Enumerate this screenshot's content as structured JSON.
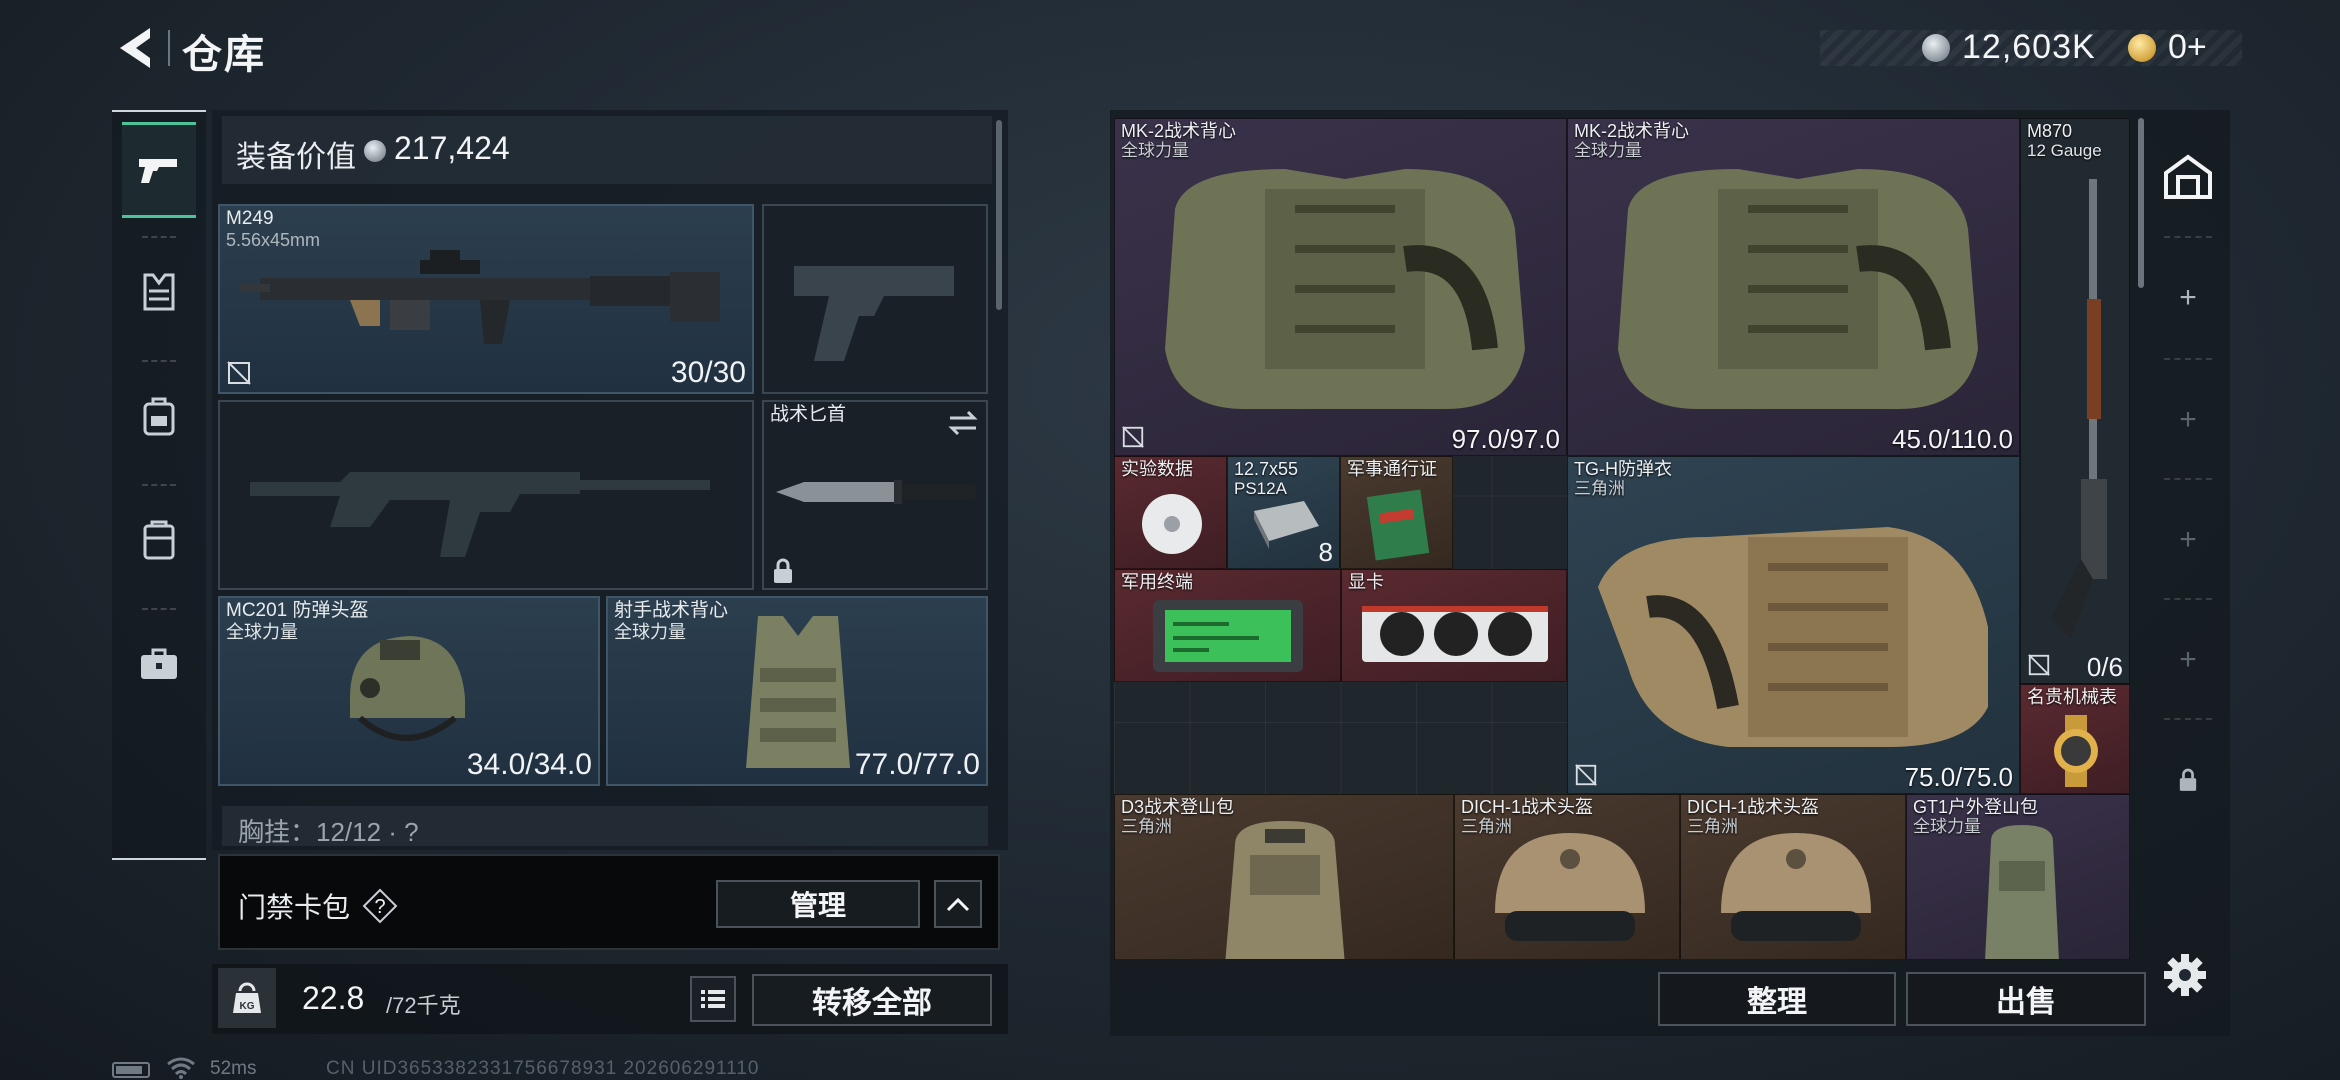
{
  "header": {
    "title": "仓库",
    "silver_amount": "12,603K",
    "gold_amount": "0+"
  },
  "sidebar": {
    "items": [
      {
        "name": "weapons",
        "icon": "pistol-icon",
        "active": true
      },
      {
        "name": "chest-rig",
        "icon": "vest-icon",
        "active": false
      },
      {
        "name": "backpack",
        "icon": "backpack-icon",
        "active": false
      },
      {
        "name": "case",
        "icon": "case-icon",
        "active": false
      },
      {
        "name": "toolbox",
        "icon": "toolbox-icon",
        "active": false
      }
    ]
  },
  "equipment": {
    "value_label": "装备价值",
    "value_amount": "217,424",
    "primary_weapon": {
      "name": "M249",
      "caliber": "5.56x45mm",
      "ammo": "30/30"
    },
    "melee": {
      "name": "战术匕首"
    },
    "helmet": {
      "name": "MC201 防弹头盔",
      "brand": "全球力量",
      "durability": "34.0/34.0"
    },
    "armor": {
      "name": "射手战术背心",
      "brand": "全球力量",
      "durability": "77.0/77.0"
    },
    "chest_rig_label": "胸挂：12/12 · ?"
  },
  "access_card": {
    "label": "门禁卡包",
    "help": "?",
    "manage_label": "管理"
  },
  "weight": {
    "value": "22.8",
    "max": "/72千克",
    "icon_text": "KG"
  },
  "transfer_label": "转移全部",
  "stash": {
    "items": [
      {
        "id": "vest-1",
        "name": "MK-2战术背心",
        "brand": "全球力量",
        "durability": "97.0/97.0",
        "rarity": "purple"
      },
      {
        "id": "vest-2",
        "name": "MK-2战术背心",
        "brand": "全球力量",
        "durability": "45.0/110.0",
        "rarity": "purple"
      },
      {
        "id": "shotgun",
        "name": "M870",
        "caliber": "12 Gauge",
        "ammo": "0/6",
        "rarity": "plain"
      },
      {
        "id": "data",
        "name": "实验数据",
        "rarity": "red"
      },
      {
        "id": "ammo",
        "name": "12.7x55",
        "sub": "PS12A",
        "qty": "8",
        "rarity": "blue"
      },
      {
        "id": "pass",
        "name": "军事通行证",
        "rarity": "brown"
      },
      {
        "id": "armor-tgh",
        "name": "TG-H防弹衣",
        "brand": "三角洲",
        "durability": "75.0/75.0",
        "rarity": "blue"
      },
      {
        "id": "terminal",
        "name": "军用终端",
        "rarity": "red"
      },
      {
        "id": "gpu",
        "name": "显卡",
        "rarity": "red"
      },
      {
        "id": "watch",
        "name": "名贵机械表",
        "rarity": "red"
      },
      {
        "id": "pack-d3",
        "name": "D3战术登山包",
        "brand": "三角洲",
        "rarity": "brown"
      },
      {
        "id": "helm-1",
        "name": "DICH-1战术头盔",
        "brand": "三角洲",
        "rarity": "brown"
      },
      {
        "id": "helm-2",
        "name": "DICH-1战术头盔",
        "brand": "三角洲",
        "rarity": "brown"
      },
      {
        "id": "pack-gt1",
        "name": "GT1户外登山包",
        "brand": "全球力量",
        "rarity": "purple"
      }
    ],
    "tabs": [
      "+",
      "+",
      "+",
      "+"
    ],
    "sort_label": "整理",
    "sell_label": "出售"
  },
  "status": {
    "ping": "52ms",
    "uid": "CN UID3653382331756678931 202606291110"
  },
  "colors": {
    "accent_green": "#4ec39a",
    "rarity_purple": "#3a324a",
    "rarity_red": "#5a2a30",
    "rarity_blue": "#2f4352",
    "rarity_brown": "#4a3a30"
  }
}
